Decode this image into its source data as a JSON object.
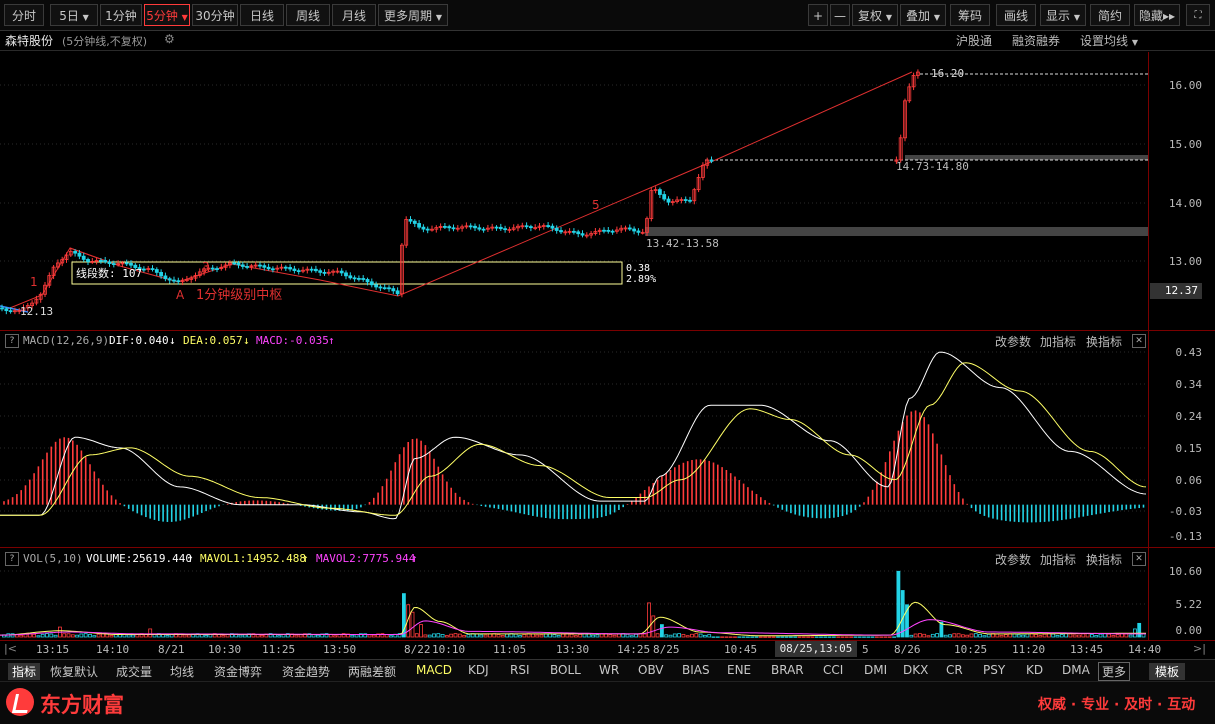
{
  "toolbar": {
    "periods": [
      "分时",
      "5日",
      "1分钟",
      "5分钟",
      "30分钟",
      "日线",
      "周线",
      "月线",
      "更多周期"
    ],
    "active_period": "5分钟",
    "right_buttons": [
      "+",
      "—",
      "复权",
      "叠加",
      "筹码",
      "画线",
      "显示",
      "简约",
      "隐藏"
    ]
  },
  "title": {
    "stock_name": "森特股份",
    "mode": "(5分钟线,不复权)",
    "right_links": [
      "沪股通",
      "融资融券",
      "设置均线"
    ]
  },
  "price_panel": {
    "y_labels": [
      "16.00",
      "15.00",
      "14.00",
      "13.00"
    ],
    "current_price": "12.37",
    "annotations": {
      "low": "12.13",
      "high": "16.20",
      "gap1": "13.42-13.58",
      "gap2": "14.73-14.80",
      "pivot_count": "线段数: 107",
      "pivot_v1": "0.38",
      "pivot_v2": "2.89%",
      "point_a": "A",
      "pivot_label": "1分钟级别中枢",
      "wave1": "1",
      "wave3": "3",
      "wave5": "5"
    }
  },
  "macd_panel": {
    "name": "MACD(12,26,9)",
    "dif": "DIF:0.040",
    "dea": "DEA:0.057",
    "macd": "MACD:-0.035",
    "y_labels": [
      "0.43",
      "0.34",
      "0.24",
      "0.15",
      "0.06",
      "-0.03",
      "-0.13"
    ],
    "buttons": [
      "改参数",
      "加指标",
      "换指标"
    ]
  },
  "vol_panel": {
    "name": "VOL(5,10)",
    "volume": "VOLUME:25619.440",
    "mavol1": "MAVOL1:14952.488",
    "mavol2": "MAVOL2:7775.944",
    "y_labels": [
      "10.60",
      "5.22",
      "0.00"
    ],
    "buttons": [
      "改参数",
      "加指标",
      "换指标"
    ]
  },
  "x_axis": {
    "labels": [
      "13:15",
      "14:10",
      "8/21",
      "10:30",
      "11:25",
      "13:50",
      "8/22",
      "10:10",
      "11:05",
      "13:30",
      "14:25",
      "8/25",
      "10:45",
      "5",
      "8/26",
      "10:25",
      "11:20",
      "13:45",
      "14:40"
    ],
    "cursor_label": "08/25,13:05"
  },
  "indicator_tabs": [
    "指标",
    "恢复默认",
    "成交量",
    "均线",
    "资金博弈",
    "资金趋势",
    "两融差额",
    "MACD",
    "KDJ",
    "RSI",
    "BOLL",
    "WR",
    "OBV",
    "BIAS",
    "ENE",
    "BRAR",
    "CCI",
    "DMI",
    "DKX",
    "CR",
    "PSY",
    "KD",
    "DMA",
    "更多",
    "模板"
  ],
  "footer": {
    "brand": "东方财富",
    "slogan": "权威 · 专业 · 及时 · 互动"
  },
  "colors": {
    "up": "#ff3b3b",
    "down": "#22d3e6",
    "dif": "#ffffff",
    "dea": "#ffff66",
    "mavol2": "#ff44ff",
    "brand": "#ff3b3b"
  }
}
